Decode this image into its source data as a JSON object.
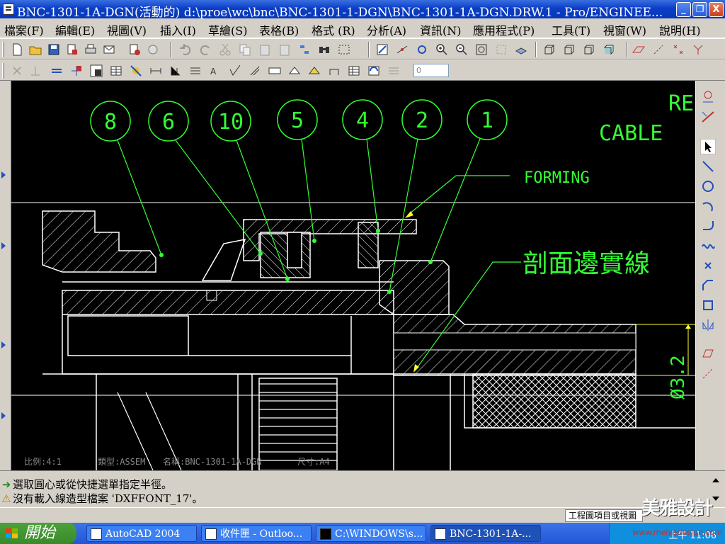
{
  "window": {
    "title": "BNC-1301-1A-DGN(活動的) d:\\proe\\wc\\bnc\\BNC-1301-1-DGN\\BNC-1301-1A-DGN.DRW.1 - Pro/ENGINEE...",
    "min_label": "_",
    "max_label": "❐",
    "close_label": "X"
  },
  "menu": [
    "檔案(F)",
    "編輯(E)",
    "視圖(V)",
    "插入(I)",
    "草繪(S)",
    "表格(B)",
    "格式 (R)",
    "分析(A)",
    "資訊(N)",
    "應用程式(P)",
    "工具(T)",
    "視窗(W)",
    "說明(H)"
  ],
  "toolbar2": {
    "spinner_value": "0"
  },
  "drawing": {
    "balloons": [
      "8",
      "6",
      "10",
      "5",
      "4",
      "2",
      "1"
    ],
    "note_forming": "FORMING",
    "note_section": "剖面邊實線",
    "note_re": "RE",
    "note_cable": "CABLE",
    "dimension": "Ø3.2",
    "info_scale": "比例:4:1",
    "info_type": "類型:ASSEM",
    "info_name": "名稱:BNC-1301-1A-DGN",
    "info_size": "尺寸:A4"
  },
  "messages": [
    {
      "icon": "arrow-icon",
      "text": "選取圓心或從快捷選單指定半徑。"
    },
    {
      "icon": "warning-icon",
      "text": "沒有載入線造型檔案 'DXFFONT_17'。"
    }
  ],
  "status": {
    "panel": "工程圖項目或視圖"
  },
  "taskbar": {
    "start": "開始",
    "tasks": [
      {
        "label": "AutoCAD 2004"
      },
      {
        "label": "收件匣 - Outloo..."
      },
      {
        "label": "C:\\WINDOWS\\s..."
      },
      {
        "label": "BNC-1301-1A-..."
      }
    ],
    "time": "上午 11:06",
    "watermark_url": "www.meiyadesign.com",
    "watermark_logo": "美雅設計"
  },
  "colors": {
    "drawing_line": "#ffffff",
    "annotation": "#33ff33",
    "leader_arrow": "#ffff00",
    "background": "#000000"
  }
}
